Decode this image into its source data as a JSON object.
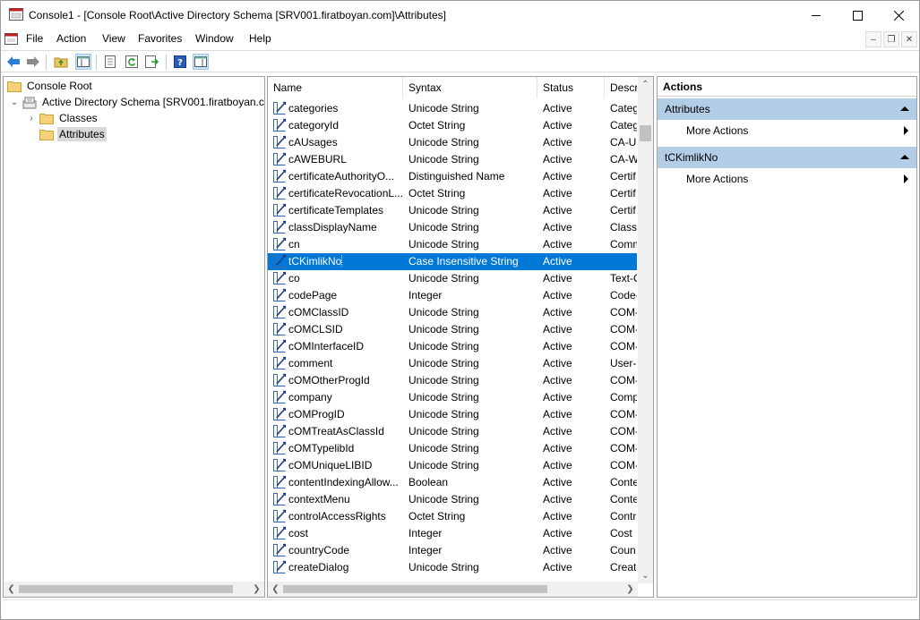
{
  "window": {
    "title": "Console1 - [Console Root\\Active Directory Schema [SRV001.firatboyan.com]\\Attributes]"
  },
  "menu": [
    "File",
    "Action",
    "View",
    "Favorites",
    "Window",
    "Help"
  ],
  "tree": {
    "root": "Console Root",
    "schema": "Active Directory Schema [SRV001.firatboyan.com]",
    "classes": "Classes",
    "attributes": "Attributes"
  },
  "list": {
    "columns": [
      "Name",
      "Syntax",
      "Status",
      "Description"
    ],
    "rows": [
      {
        "name": "categories",
        "syntax": "Unicode String",
        "status": "Active",
        "desc": "Categ"
      },
      {
        "name": "categoryId",
        "syntax": "Octet String",
        "status": "Active",
        "desc": "Categ"
      },
      {
        "name": "cAUsages",
        "syntax": "Unicode String",
        "status": "Active",
        "desc": "CA-U"
      },
      {
        "name": "cAWEBURL",
        "syntax": "Unicode String",
        "status": "Active",
        "desc": "CA-W"
      },
      {
        "name": "certificateAuthorityO...",
        "syntax": "Distinguished Name",
        "status": "Active",
        "desc": "Certif"
      },
      {
        "name": "certificateRevocationL...",
        "syntax": "Octet String",
        "status": "Active",
        "desc": "Certif"
      },
      {
        "name": "certificateTemplates",
        "syntax": "Unicode String",
        "status": "Active",
        "desc": "Certif"
      },
      {
        "name": "classDisplayName",
        "syntax": "Unicode String",
        "status": "Active",
        "desc": "Class-"
      },
      {
        "name": "cn",
        "syntax": "Unicode String",
        "status": "Active",
        "desc": "Comm"
      },
      {
        "name": "tCKimlikNo",
        "syntax": "Case Insensitive String",
        "status": "Active",
        "desc": "",
        "selected": true
      },
      {
        "name": "co",
        "syntax": "Unicode String",
        "status": "Active",
        "desc": "Text-C"
      },
      {
        "name": "codePage",
        "syntax": "Integer",
        "status": "Active",
        "desc": "Code-"
      },
      {
        "name": "cOMClassID",
        "syntax": "Unicode String",
        "status": "Active",
        "desc": "COM-"
      },
      {
        "name": "cOMCLSID",
        "syntax": "Unicode String",
        "status": "Active",
        "desc": "COM-"
      },
      {
        "name": "cOMInterfaceID",
        "syntax": "Unicode String",
        "status": "Active",
        "desc": "COM-"
      },
      {
        "name": "comment",
        "syntax": "Unicode String",
        "status": "Active",
        "desc": "User-C"
      },
      {
        "name": "cOMOtherProgId",
        "syntax": "Unicode String",
        "status": "Active",
        "desc": "COM-"
      },
      {
        "name": "company",
        "syntax": "Unicode String",
        "status": "Active",
        "desc": "Comp"
      },
      {
        "name": "cOMProgID",
        "syntax": "Unicode String",
        "status": "Active",
        "desc": "COM-"
      },
      {
        "name": "cOMTreatAsClassId",
        "syntax": "Unicode String",
        "status": "Active",
        "desc": "COM-"
      },
      {
        "name": "cOMTypelibId",
        "syntax": "Unicode String",
        "status": "Active",
        "desc": "COM-"
      },
      {
        "name": "cOMUniqueLIBID",
        "syntax": "Unicode String",
        "status": "Active",
        "desc": "COM-"
      },
      {
        "name": "contentIndexingAllow...",
        "syntax": "Boolean",
        "status": "Active",
        "desc": "Conte"
      },
      {
        "name": "contextMenu",
        "syntax": "Unicode String",
        "status": "Active",
        "desc": "Conte"
      },
      {
        "name": "controlAccessRights",
        "syntax": "Octet String",
        "status": "Active",
        "desc": "Contr"
      },
      {
        "name": "cost",
        "syntax": "Integer",
        "status": "Active",
        "desc": "Cost"
      },
      {
        "name": "countryCode",
        "syntax": "Integer",
        "status": "Active",
        "desc": "Coun"
      },
      {
        "name": "createDialog",
        "syntax": "Unicode String",
        "status": "Active",
        "desc": "Create"
      }
    ]
  },
  "actions": {
    "title": "Actions",
    "sections": [
      {
        "title": "Attributes",
        "items": [
          "More Actions"
        ]
      },
      {
        "title": "tCKimlikNo",
        "items": [
          "More Actions"
        ]
      }
    ]
  }
}
